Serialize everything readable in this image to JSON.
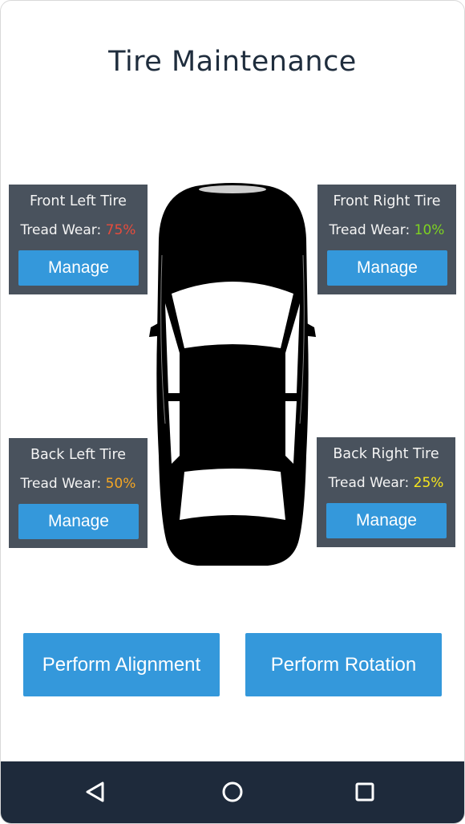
{
  "screen": {
    "title": "Tire Maintenance"
  },
  "tires": {
    "front_left": {
      "name": "Front Left Tire",
      "wear_label": "Tread Wear: ",
      "wear_value": "75%",
      "wear_color": "#e74c3c",
      "button": "Manage"
    },
    "front_right": {
      "name": "Front Right Tire",
      "wear_label": "Tread Wear: ",
      "wear_value": "10%",
      "wear_color": "#7ed321",
      "button": "Manage"
    },
    "back_left": {
      "name": "Back Left Tire",
      "wear_label": "Tread Wear: ",
      "wear_value": "50%",
      "wear_color": "#f5a623",
      "button": "Manage"
    },
    "back_right": {
      "name": "Back Right Tire",
      "wear_label": "Tread Wear: ",
      "wear_value": "25%",
      "wear_color": "#f8e71c",
      "button": "Manage"
    }
  },
  "actions": {
    "alignment": "Perform Alignment",
    "rotation": "Perform Rotation"
  },
  "colors": {
    "accent": "#3498db",
    "card": "#49525d",
    "navbar": "#1e2a3b"
  },
  "navbar": {
    "back_icon": "back-triangle-icon",
    "home_icon": "home-circle-icon",
    "recents_icon": "recents-square-icon"
  }
}
